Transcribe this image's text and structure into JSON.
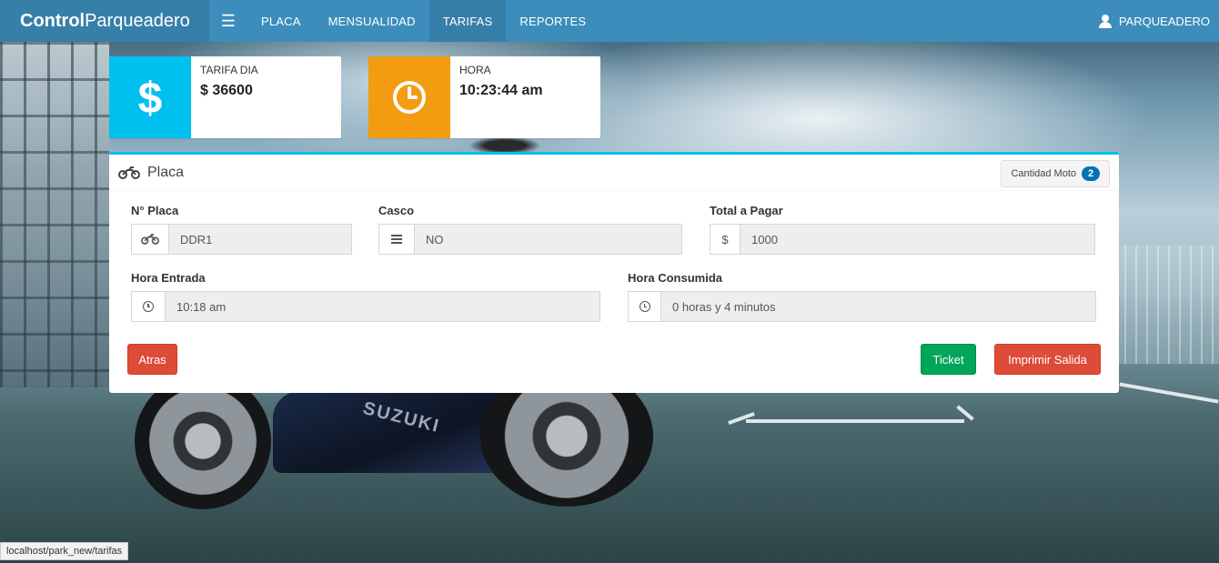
{
  "brand": {
    "bold": "Control",
    "light": "Parqueadero"
  },
  "nav": {
    "items": [
      {
        "label": "PLACA"
      },
      {
        "label": "MENSUALIDAD"
      },
      {
        "label": "TARIFAS"
      },
      {
        "label": "REPORTES"
      }
    ],
    "active_index": 2,
    "user": "PARQUEADERO"
  },
  "info_boxes": {
    "tarifa": {
      "title": "TARIFA DIA",
      "value": "$ 36600",
      "color": "#00c0ef",
      "icon": "dollar-icon"
    },
    "hora": {
      "title": "HORA",
      "value": "10:23:44 am",
      "color": "#f39c12",
      "icon": "clock-icon"
    }
  },
  "panel": {
    "title": "Placa",
    "count_label": "Cantidad Moto",
    "count_value": "2",
    "fields": {
      "placa": {
        "label": "N° Placa",
        "value": "DDR1"
      },
      "casco": {
        "label": "Casco",
        "value": "NO"
      },
      "total": {
        "label": "Total a Pagar",
        "value": "1000",
        "addon": "$"
      },
      "entrada": {
        "label": "Hora Entrada",
        "value": "10:18 am"
      },
      "consumida": {
        "label": "Hora Consumida",
        "value": "0 horas y 4 minutos"
      }
    },
    "buttons": {
      "atras": "Atras",
      "ticket": "Ticket",
      "imprimir": "Imprimir Salida"
    }
  },
  "background_text": {
    "brand": "SUZUKI"
  },
  "statusbar": {
    "url": "localhost/park_new/tarifas"
  }
}
